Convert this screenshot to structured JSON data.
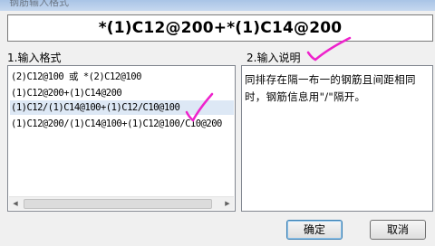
{
  "window": {
    "title": "钢筋输入格式"
  },
  "formula": {
    "text": "*(1)C12@200+*(1)C14@200"
  },
  "format_section": {
    "label": "1.输入格式",
    "items": [
      {
        "text": "(2)C12@100 或 *(2)C12@100"
      },
      {
        "text": "(1)C12@200+(1)C14@200"
      },
      {
        "text": "(1)C12/(1)C14@100+(1)C12/C10@100"
      },
      {
        "text": "(1)C12@200/(1)C14@100+(1)C12@100/C10@200"
      }
    ],
    "selected_index": 2
  },
  "description_section": {
    "label": "2.输入说明",
    "text": "同排存在隔一布一的钢筋且间距相同时，钢筋信息用\"/\"隔开。"
  },
  "buttons": {
    "ok_label": "确定",
    "cancel_label": "取消"
  },
  "annotations": {
    "mark_color": "#ee22cc"
  }
}
